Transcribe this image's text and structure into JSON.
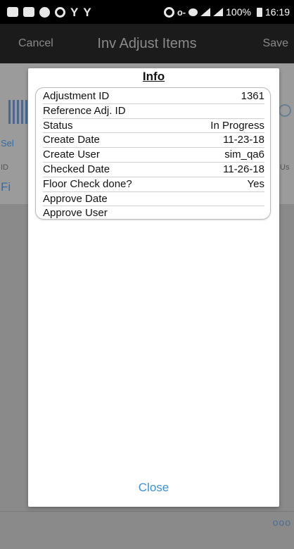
{
  "status_bar": {
    "battery": "100%",
    "time": "16:19"
  },
  "header": {
    "cancel_label": "Cancel",
    "title": "Inv Adjust Items",
    "save_label": "Save"
  },
  "background": {
    "select_label": "Sel",
    "id_label": "ID",
    "filter_label": "Fi",
    "us_label": "Us",
    "more_label": "ooo"
  },
  "dialog": {
    "title": "Info",
    "rows": [
      {
        "label": "Adjustment ID",
        "value": "1361"
      },
      {
        "label": "Reference Adj. ID",
        "value": ""
      },
      {
        "label": "Status",
        "value": "In Progress"
      },
      {
        "label": "Create Date",
        "value": "11-23-18"
      },
      {
        "label": "Create User",
        "value": "sim_qa6"
      },
      {
        "label": "Checked Date",
        "value": "11-26-18"
      },
      {
        "label": "Floor Check done?",
        "value": "Yes"
      },
      {
        "label": "Approve Date",
        "value": ""
      },
      {
        "label": "Approve User",
        "value": ""
      }
    ],
    "close_label": "Close"
  }
}
